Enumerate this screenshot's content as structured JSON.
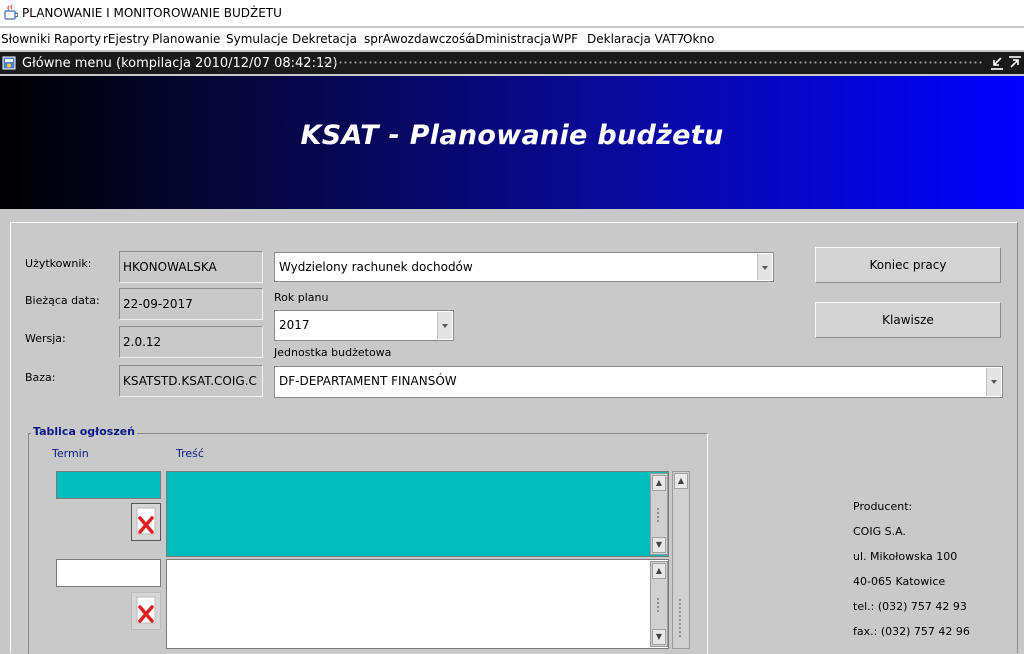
{
  "window": {
    "title": "PLANOWANIE I MONITOROWANIE BUDŻETU"
  },
  "menu": [
    "Słowniki",
    "Raporty",
    "rEjestry",
    "Planowanie",
    "Symulacje",
    "Dekretacja",
    "sprAwozdawczość",
    "aDministracja",
    "WPF",
    "Deklaracja VAT7",
    "Okno"
  ],
  "inner_window": {
    "title": "Główne menu (kompilacja 2010/12/07 08:42:12)"
  },
  "banner": {
    "title": "KSAT - Planowanie budżetu"
  },
  "form": {
    "user_label": "Użytkownik:",
    "user_value": "HKONOWALSKA",
    "date_label": "Bieżąca data:",
    "date_value": "22-09-2017",
    "version_label": "Wersja:",
    "version_value": "2.0.12",
    "base_label": "Baza:",
    "base_value": "KSATSTD.KSAT.COIG.C",
    "account_value": "Wydzielony rachunek dochodów",
    "year_label": "Rok planu",
    "year_value": "2017",
    "unit_label": "Jednostka budżetowa",
    "unit_value": "DF-DEPARTAMENT FINANSÓW"
  },
  "buttons": {
    "exit": "Koniec pracy",
    "keys": "Klawisze"
  },
  "board": {
    "title": "Tablica ogłoszeń",
    "col_term": "Termin",
    "col_content": "Treść"
  },
  "producer": {
    "label": "Producent:",
    "company": "COIG S.A.",
    "street": "ul. Mikołowska 100",
    "city": "40-065 Katowice",
    "tel": "tel.: (032) 757 42 93",
    "fax": "fax.: (032) 757 42 96"
  },
  "colors": {
    "accent_row": "#00bdbd",
    "banner_dark": "#000000",
    "banner_blue": "#0000ff",
    "board_header": "#0a1a8a",
    "delete_icon": "#e02020"
  }
}
